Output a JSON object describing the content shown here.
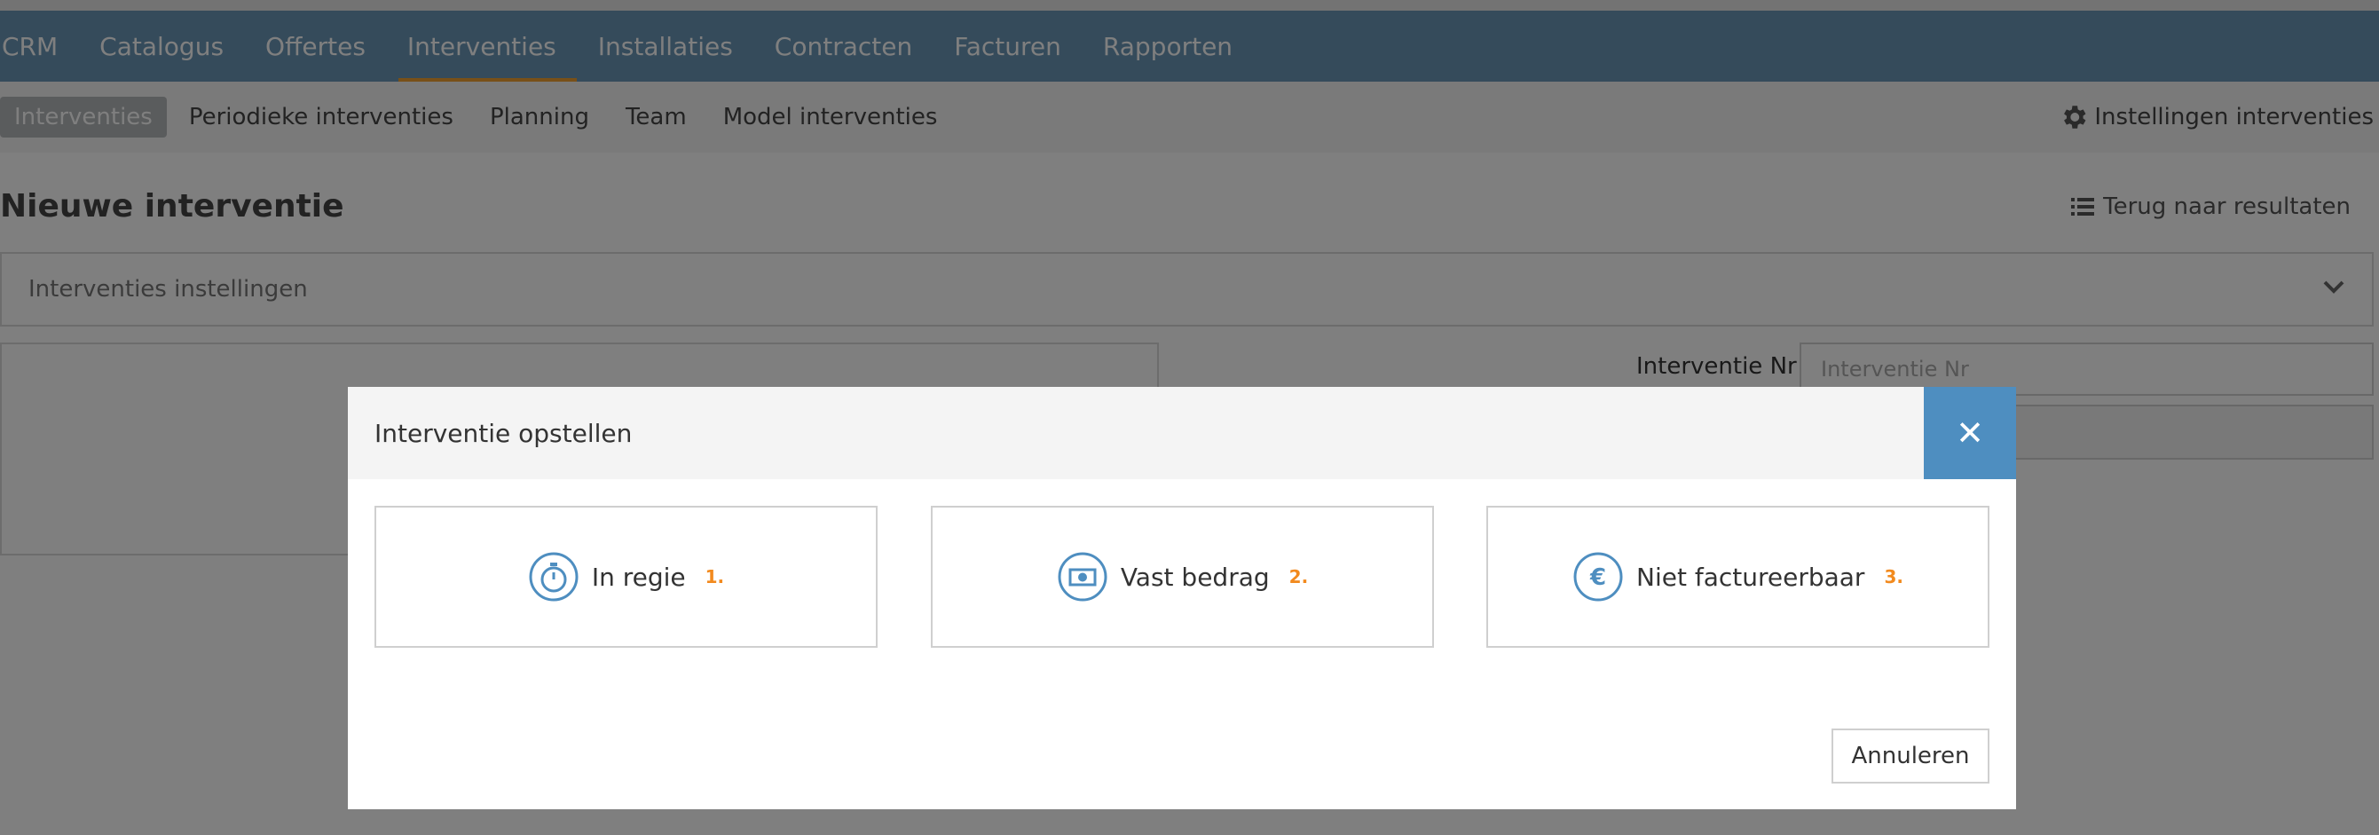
{
  "main_nav": {
    "items": [
      {
        "label": "CRM"
      },
      {
        "label": "Catalogus"
      },
      {
        "label": "Offertes"
      },
      {
        "label": "Interventies",
        "active": true
      },
      {
        "label": "Installaties"
      },
      {
        "label": "Contracten"
      },
      {
        "label": "Facturen"
      },
      {
        "label": "Rapporten"
      }
    ]
  },
  "sub_nav": {
    "items": [
      {
        "label": "Interventies",
        "active": true
      },
      {
        "label": "Periodieke interventies"
      },
      {
        "label": "Planning"
      },
      {
        "label": "Team"
      },
      {
        "label": "Model interventies"
      }
    ],
    "settings_label": "Instellingen interventies",
    "settings_icon": "gear-icon"
  },
  "page": {
    "title": "Nieuwe interventie",
    "back_link": "Terug naar resultaten",
    "back_icon": "list-icon"
  },
  "settings_panel": {
    "label": "Interventies instellingen",
    "icon": "chevron-down-icon"
  },
  "form": {
    "interventie_nr_label": "Interventie Nr",
    "interventie_nr_placeholder": "Interventie Nr"
  },
  "modal": {
    "title": "Interventie opstellen",
    "close_icon": "close-icon",
    "options": [
      {
        "label": "In regie",
        "number": "1.",
        "icon": "stopwatch-icon"
      },
      {
        "label": "Vast bedrag",
        "number": "2.",
        "icon": "money-icon"
      },
      {
        "label": "Niet factureerbaar",
        "number": "3.",
        "icon": "euro-icon"
      }
    ],
    "cancel_label": "Annuleren"
  },
  "colors": {
    "nav_bg": "#6a96b6",
    "active_underline": "#f0a030",
    "close_button": "#4e8ec0",
    "option_icon": "#4e8ec0",
    "option_number": "#f28a1e"
  }
}
